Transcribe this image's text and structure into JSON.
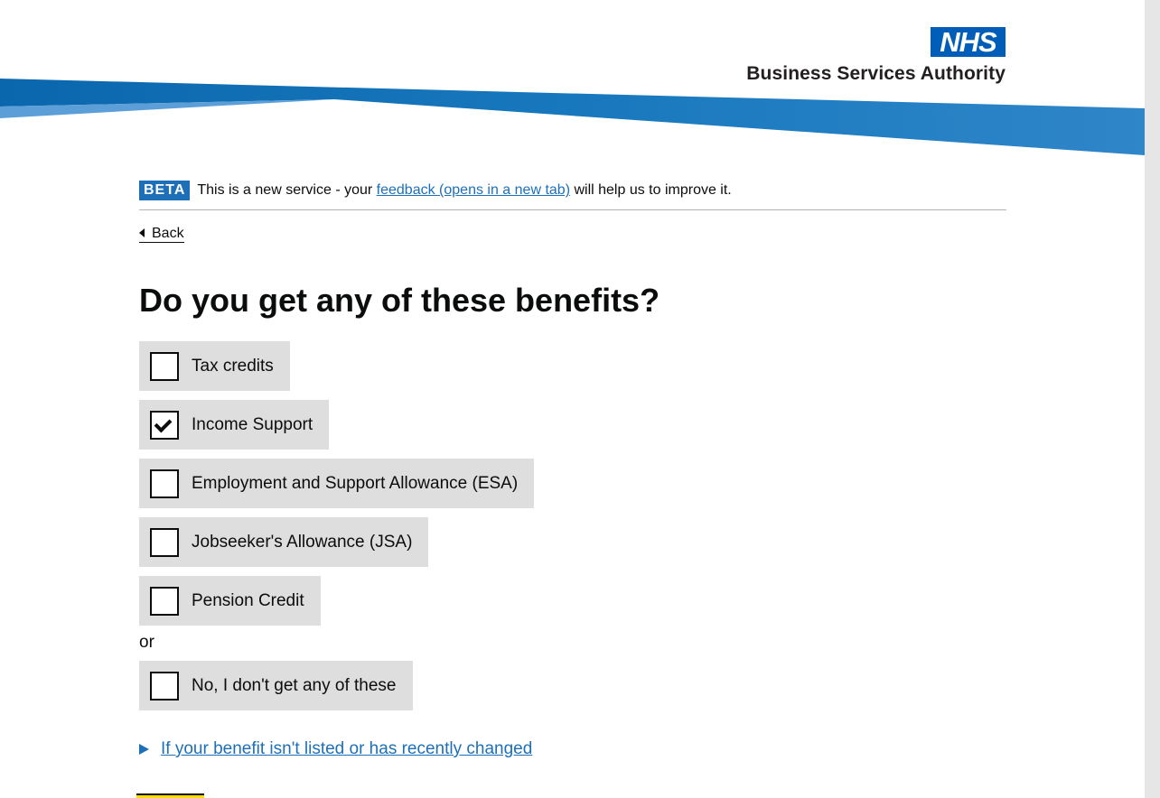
{
  "header": {
    "logo_text": "NHS",
    "org_name": "Business Services Authority",
    "colors": {
      "nhs_blue": "#005eb8",
      "swoosh_dark": "#1d70b8",
      "swoosh_light": "#41b6e6"
    }
  },
  "beta_banner": {
    "tag": "BETA",
    "text_before": "This is a new service - your ",
    "link_text": "feedback (opens in a new tab)",
    "text_after": " will help us to improve it."
  },
  "back_link": "Back",
  "page_title": "Do you get any of these benefits?",
  "options": [
    {
      "label": "Tax credits",
      "checked": false
    },
    {
      "label": "Income Support",
      "checked": true
    },
    {
      "label": "Employment and Support Allowance (ESA)",
      "checked": false
    },
    {
      "label": "Jobseeker's Allowance (JSA)",
      "checked": false
    },
    {
      "label": "Pension Credit",
      "checked": false
    }
  ],
  "or_text": "or",
  "none_option": {
    "label": "No, I don't get any of these",
    "checked": false
  },
  "details_link": "If your benefit isn't listed or has recently changed"
}
